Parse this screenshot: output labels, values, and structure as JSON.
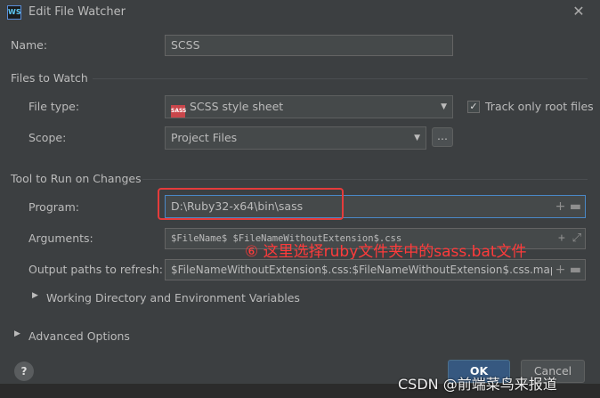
{
  "window": {
    "title": "Edit File Watcher",
    "app_icon": "WS"
  },
  "name": {
    "label": "Name:",
    "value": "SCSS"
  },
  "files_to_watch": {
    "heading": "Files to Watch",
    "file_type_label": "File type:",
    "file_type_value": "SCSS style sheet",
    "file_type_icon": "SASS",
    "track_root_label": "Track only root files",
    "track_root_checked": true,
    "scope_label": "Scope:",
    "scope_value": "Project Files",
    "scope_button": "..."
  },
  "tool": {
    "heading": "Tool to Run on Changes",
    "program_label": "Program:",
    "program_value": "D:\\Ruby32-x64\\bin\\sass",
    "arguments_label": "Arguments:",
    "arguments_value": "$FileName$ $FileNameWithoutExtension$.css",
    "output_label": "Output paths to refresh:",
    "output_value": "$FileNameWithoutExtension$.css:$FileNameWithoutExtension$.css.map",
    "working_dir_label": "Working Directory and Environment Variables"
  },
  "advanced": {
    "label": "Advanced Options"
  },
  "annotation": {
    "text": "⑥ 这里选择ruby文件夹中的sass.bat文件"
  },
  "buttons": {
    "ok": "OK",
    "cancel": "Cancel",
    "help": "?"
  },
  "watermark": "CSDN @前端菜鸟来报道",
  "colors": {
    "accent": "#365880",
    "annotation": "#e53b3b",
    "background": "#3c3f41",
    "focus": "#4a88c7"
  }
}
